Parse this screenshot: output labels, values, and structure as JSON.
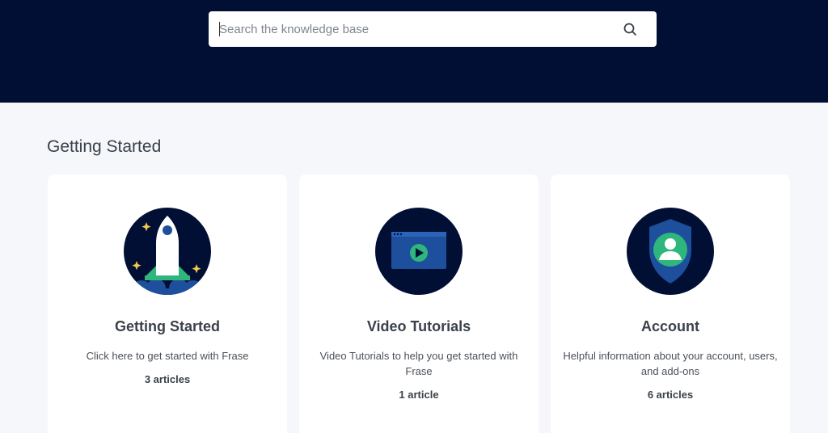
{
  "search": {
    "placeholder": "Search the knowledge base",
    "icon": "search-icon"
  },
  "colors": {
    "hero_background": "#010f35",
    "page_background": "#f5f7fa",
    "icon_circle": "#010f35",
    "accent_green": "#2eb67d",
    "accent_blue": "#1d4f9c"
  },
  "section": {
    "title": "Getting Started"
  },
  "cards": [
    {
      "icon": "rocket-icon",
      "title": "Getting Started",
      "description": "Click here to get started with Frase",
      "count": "3 articles"
    },
    {
      "icon": "video-player-icon",
      "title": "Video Tutorials",
      "description": "Video Tutorials to help you get started with Frase",
      "count": "1 article"
    },
    {
      "icon": "shield-user-icon",
      "title": "Account",
      "description": "Helpful information about your account, users, and add-ons",
      "count": "6 articles"
    }
  ]
}
